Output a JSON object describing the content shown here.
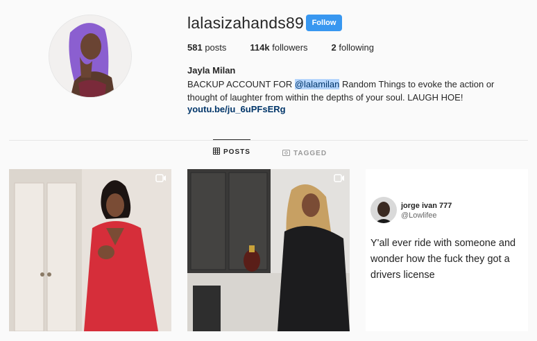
{
  "profile": {
    "username": "lalasizahands89",
    "follow_label": "Follow",
    "posts_count": "581",
    "posts_label": "posts",
    "followers_count": "114k",
    "followers_label": "followers",
    "following_count": "2",
    "following_label": "following",
    "full_name": "Jayla Milan",
    "bio_prefix": "BACKUP ACCOUNT FOR ",
    "bio_mention": "@lalamilan",
    "bio_suffix": " Random Things to evoke the action or thought of laughter from within the depths of your soul. LAUGH HOE!",
    "link": "youtu.be/ju_6uPFsERg"
  },
  "tabs": [
    {
      "label": "POSTS",
      "icon": "grid-icon",
      "active": true
    },
    {
      "label": "TAGGED",
      "icon": "tag-icon",
      "active": false
    }
  ],
  "posts": [
    {
      "type": "video",
      "icon": "video-icon"
    },
    {
      "type": "video",
      "icon": "video-icon"
    },
    {
      "type": "tweet",
      "tweet_name": "jorge ivan 777",
      "tweet_handle": "@Lowlifee",
      "tweet_text": "Y'all ever ride with someone and wonder how the fuck they got a drivers license"
    }
  ],
  "colors": {
    "follow_button": "#3897f0",
    "link": "#003569",
    "mention_highlight": "#b3d4fc"
  }
}
